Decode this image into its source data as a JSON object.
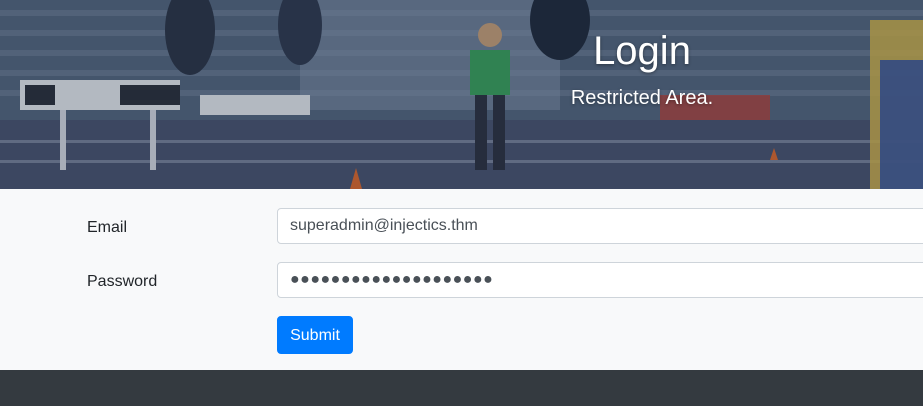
{
  "hero": {
    "title": "Login",
    "subtitle": "Restricted Area."
  },
  "form": {
    "email_label": "Email",
    "email_value": "superadmin@injectics.thm",
    "password_label": "Password",
    "password_value": "●●●●●●●●●●●●●●●●●●●●",
    "submit_label": "Submit"
  },
  "colors": {
    "primary": "#007bff",
    "footer": "#343a40",
    "form_background": "#f8f9fa"
  }
}
